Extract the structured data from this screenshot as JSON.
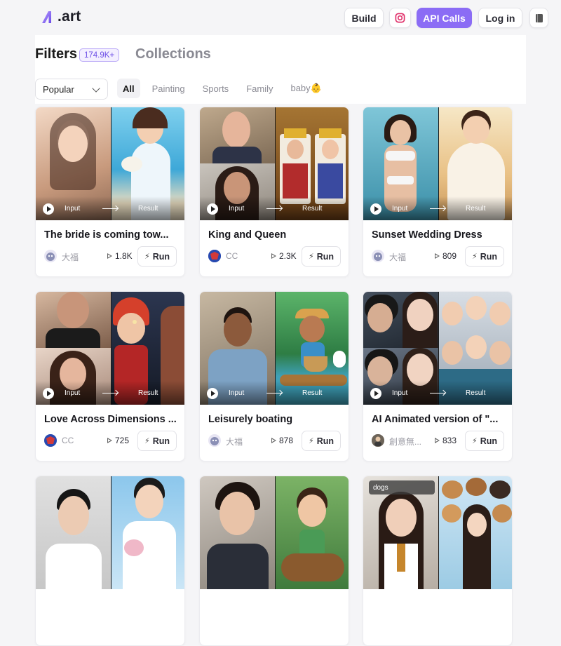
{
  "header": {
    "logo_text": ".art",
    "build_label": "Build",
    "instagram_icon": "instagram-icon",
    "api_label": "API Calls",
    "login_label": "Log in",
    "menu_icon": "book-icon"
  },
  "filters": {
    "title": "Filters",
    "count": "174.9K+",
    "collections": "Collections",
    "sort_value": "Popular",
    "tabs": [
      "All",
      "Painting",
      "Sports",
      "Family",
      "baby👶"
    ]
  },
  "colors": {
    "accent": "#8b6cf5",
    "text": "#1a1a1a",
    "muted": "#8c8c95"
  },
  "card_labels": {
    "input": "Input",
    "result": "Result",
    "run": "Run"
  },
  "cards": [
    {
      "title": "The bride is coming tow...",
      "author": "大福",
      "runs": "1.8K"
    },
    {
      "title": "King and Queen",
      "author": "CC",
      "runs": "2.3K"
    },
    {
      "title": "Sunset Wedding Dress",
      "author": "大福",
      "runs": "809"
    },
    {
      "title": "Love Across Dimensions ...",
      "author": "CC",
      "runs": "725"
    },
    {
      "title": "Leisurely boating",
      "author": "大福",
      "runs": "878"
    },
    {
      "title": "AI Animated version of \"...",
      "author": "創意無...",
      "runs": "833"
    },
    {
      "title": "",
      "author": "",
      "runs": ""
    },
    {
      "title": "",
      "author": "",
      "runs": ""
    },
    {
      "title": "",
      "author": "",
      "runs": "",
      "tag": "dogs"
    }
  ]
}
